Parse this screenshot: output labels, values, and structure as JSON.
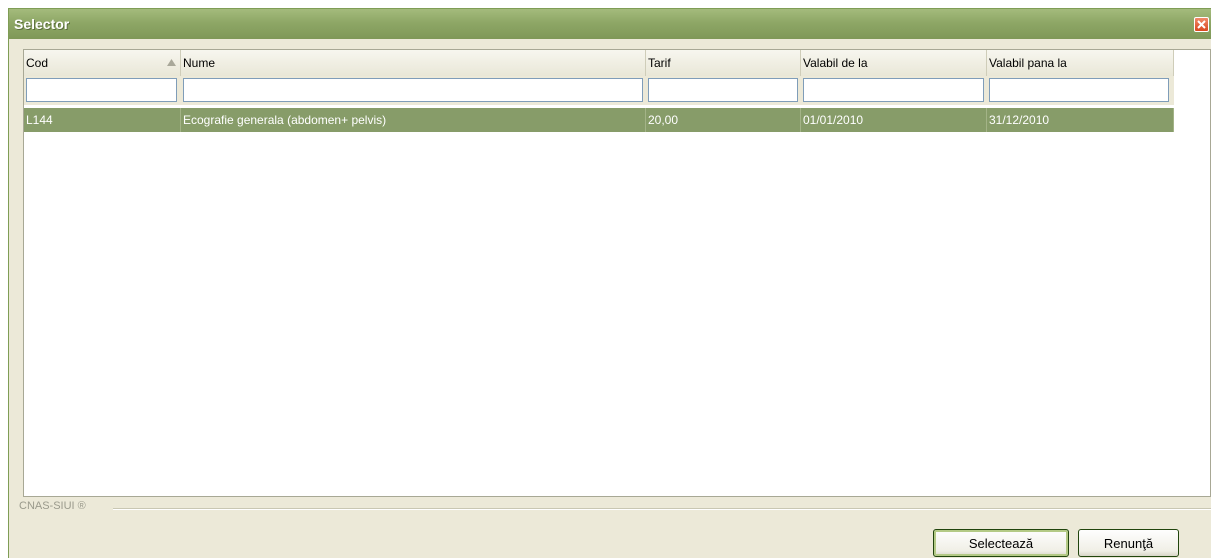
{
  "window": {
    "title": "Selector"
  },
  "grid": {
    "columns": [
      {
        "label": "Cod"
      },
      {
        "label": "Nume"
      },
      {
        "label": "Tarif"
      },
      {
        "label": "Valabil de la"
      },
      {
        "label": "Valabil pana la"
      }
    ],
    "filters": [
      "",
      "",
      "",
      "",
      ""
    ],
    "rows": [
      {
        "cod": "L144",
        "nume": "Ecografie  generala (abdomen+ pelvis)",
        "tarif": "20,00",
        "valabil_de_la": "01/01/2010",
        "valabil_pana_la": "31/12/2010"
      }
    ],
    "sorted_column": "Cod"
  },
  "footer": {
    "brand": "CNAS-SIUI ®"
  },
  "buttons": {
    "select": "Selectează",
    "cancel": "Renunţă"
  },
  "colors": {
    "titlebar": "#8ea766",
    "selected_row": "#879c69",
    "close": "#d9471e"
  },
  "icons": {
    "close": "close-icon",
    "sort": "sort-ascending-icon"
  }
}
